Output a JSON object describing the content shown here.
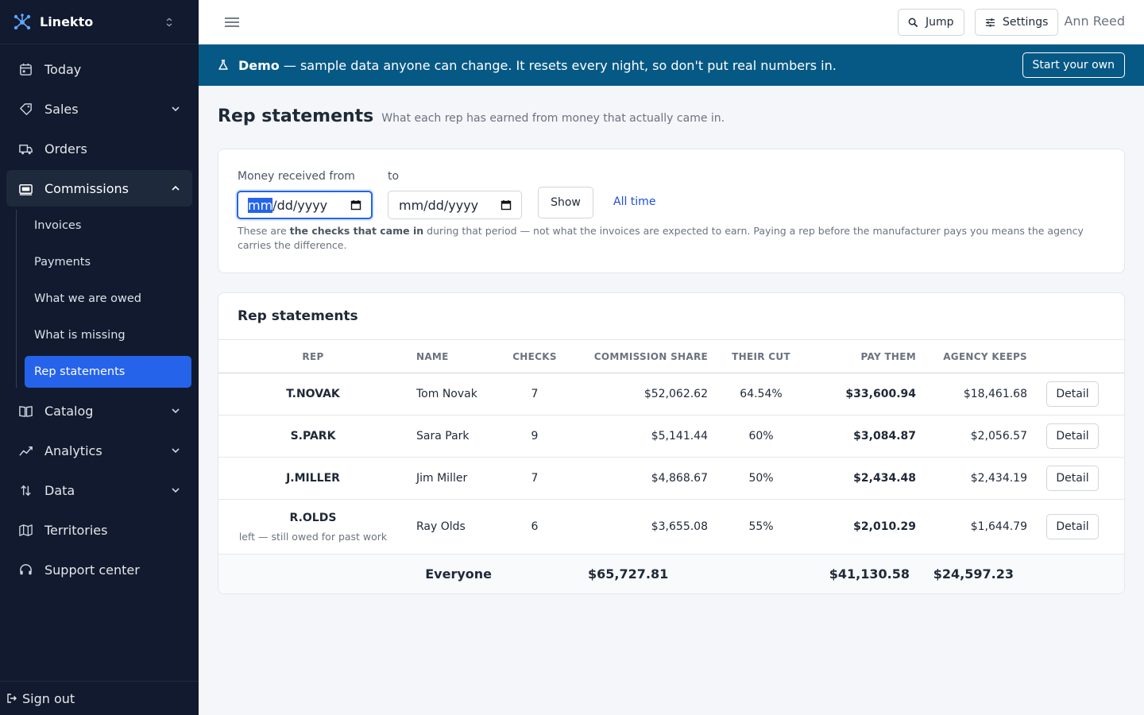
{
  "app": {
    "name": "Linekto"
  },
  "sidebar": {
    "items": [
      {
        "label": "Today",
        "icon": "calendar-icon"
      },
      {
        "label": "Sales",
        "icon": "tag-icon"
      },
      {
        "label": "Orders",
        "icon": "truck-icon"
      },
      {
        "label": "Commissions",
        "icon": "money-icon"
      },
      {
        "label": "Catalog",
        "icon": "book-icon"
      },
      {
        "label": "Analytics",
        "icon": "trend-icon"
      },
      {
        "label": "Data",
        "icon": "sort-icon"
      },
      {
        "label": "Territories",
        "icon": "map-icon"
      },
      {
        "label": "Support center",
        "icon": "headset-icon"
      }
    ],
    "commissions_sub": [
      {
        "label": "Invoices"
      },
      {
        "label": "Payments"
      },
      {
        "label": "What we are owed"
      },
      {
        "label": "What is missing"
      },
      {
        "label": "Rep statements"
      }
    ],
    "sign_out": "Sign out"
  },
  "topbar": {
    "jump": "Jump",
    "settings": "Settings",
    "user": "Ann Reed"
  },
  "banner": {
    "strong": "Demo",
    "text": " — sample data anyone can change. It resets every night, so don't put real numbers in.",
    "button": "Start your own",
    "color": "#075985"
  },
  "page": {
    "title": "Rep statements",
    "subtitle": "What each rep has earned from money that actually came in."
  },
  "filter": {
    "from_label": "Money received from",
    "to_label": "to",
    "from_placeholder_mm": "mm",
    "from_placeholder_rest": "/dd/yyyy",
    "to_placeholder": "mm/dd/yyyy",
    "show": "Show",
    "all_time": "All time",
    "note_before": "These are ",
    "note_bold": "the checks that came in",
    "note_after": " during that period — not what the invoices are expected to earn. Paying a rep before the manufacturer pays you means the agency carries the difference."
  },
  "table": {
    "title": "Rep statements",
    "columns": [
      "REP",
      "NAME",
      "CHECKS",
      "COMMISSION SHARE",
      "THEIR CUT",
      "PAY THEM",
      "AGENCY KEEPS"
    ],
    "rows": [
      {
        "rep": "T.NOVAK",
        "note": "",
        "name": "Tom Novak",
        "checks": "7",
        "share": "$52,062.62",
        "cut": "64.54%",
        "pay": "$33,600.94",
        "keeps": "$18,461.68",
        "action": "Detail"
      },
      {
        "rep": "S.PARK",
        "note": "",
        "name": "Sara Park",
        "checks": "9",
        "share": "$5,141.44",
        "cut": "60%",
        "pay": "$3,084.87",
        "keeps": "$2,056.57",
        "action": "Detail"
      },
      {
        "rep": "J.MILLER",
        "note": "",
        "name": "Jim Miller",
        "checks": "7",
        "share": "$4,868.67",
        "cut": "50%",
        "pay": "$2,434.48",
        "keeps": "$2,434.19",
        "action": "Detail"
      },
      {
        "rep": "R.OLDS",
        "note": "left — still owed for past work",
        "name": "Ray Olds",
        "checks": "6",
        "share": "$3,655.08",
        "cut": "55%",
        "pay": "$2,010.29",
        "keeps": "$1,644.79",
        "action": "Detail"
      }
    ],
    "totals": {
      "label": "Everyone",
      "share": "$65,727.81",
      "pay": "$41,130.58",
      "keeps": "$24,597.23"
    }
  },
  "colors": {
    "sidebar": "#111a2e",
    "accent": "#2563eb",
    "link": "#1d4ed8"
  }
}
